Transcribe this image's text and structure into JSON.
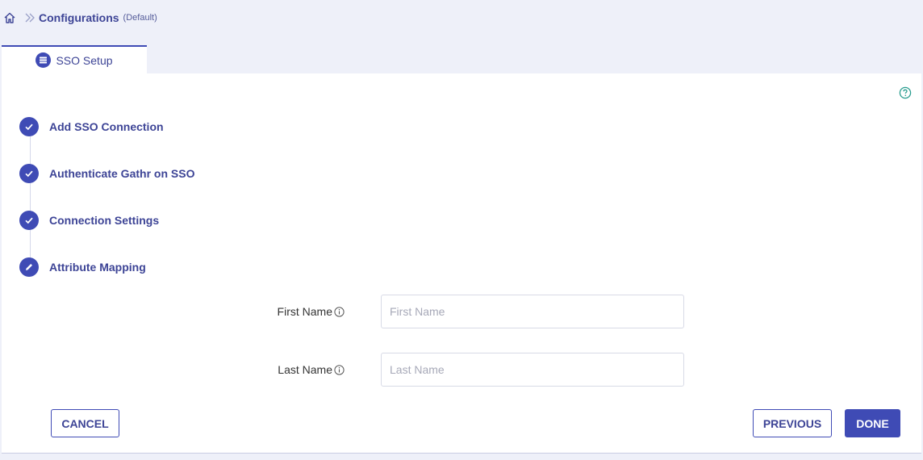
{
  "breadcrumb": {
    "home_icon": "home-icon",
    "separator_icon": "double-chevron-right-icon",
    "title": "Configurations",
    "subtitle": "(Default)"
  },
  "tab": {
    "label": "SSO Setup",
    "icon": "sso-setup-icon"
  },
  "help_icon": "help-circle-icon",
  "steps": [
    {
      "label": "Add SSO Connection",
      "status": "completed",
      "icon": "check-icon"
    },
    {
      "label": "Authenticate Gathr on SSO",
      "status": "completed",
      "icon": "check-icon"
    },
    {
      "label": "Connection Settings",
      "status": "completed",
      "icon": "check-icon"
    },
    {
      "label": "Attribute Mapping",
      "status": "active",
      "icon": "pencil-icon"
    }
  ],
  "form": {
    "first_name": {
      "label": "First Name",
      "placeholder": "First Name",
      "value": ""
    },
    "last_name": {
      "label": "Last Name",
      "placeholder": "Last Name",
      "value": ""
    }
  },
  "buttons": {
    "cancel": "CANCEL",
    "previous": "PREVIOUS",
    "done": "DONE"
  },
  "colors": {
    "accent": "#3f4bb5",
    "background": "#eef0f9",
    "text_primary": "#3d4496",
    "help": "#2a9d8f"
  }
}
